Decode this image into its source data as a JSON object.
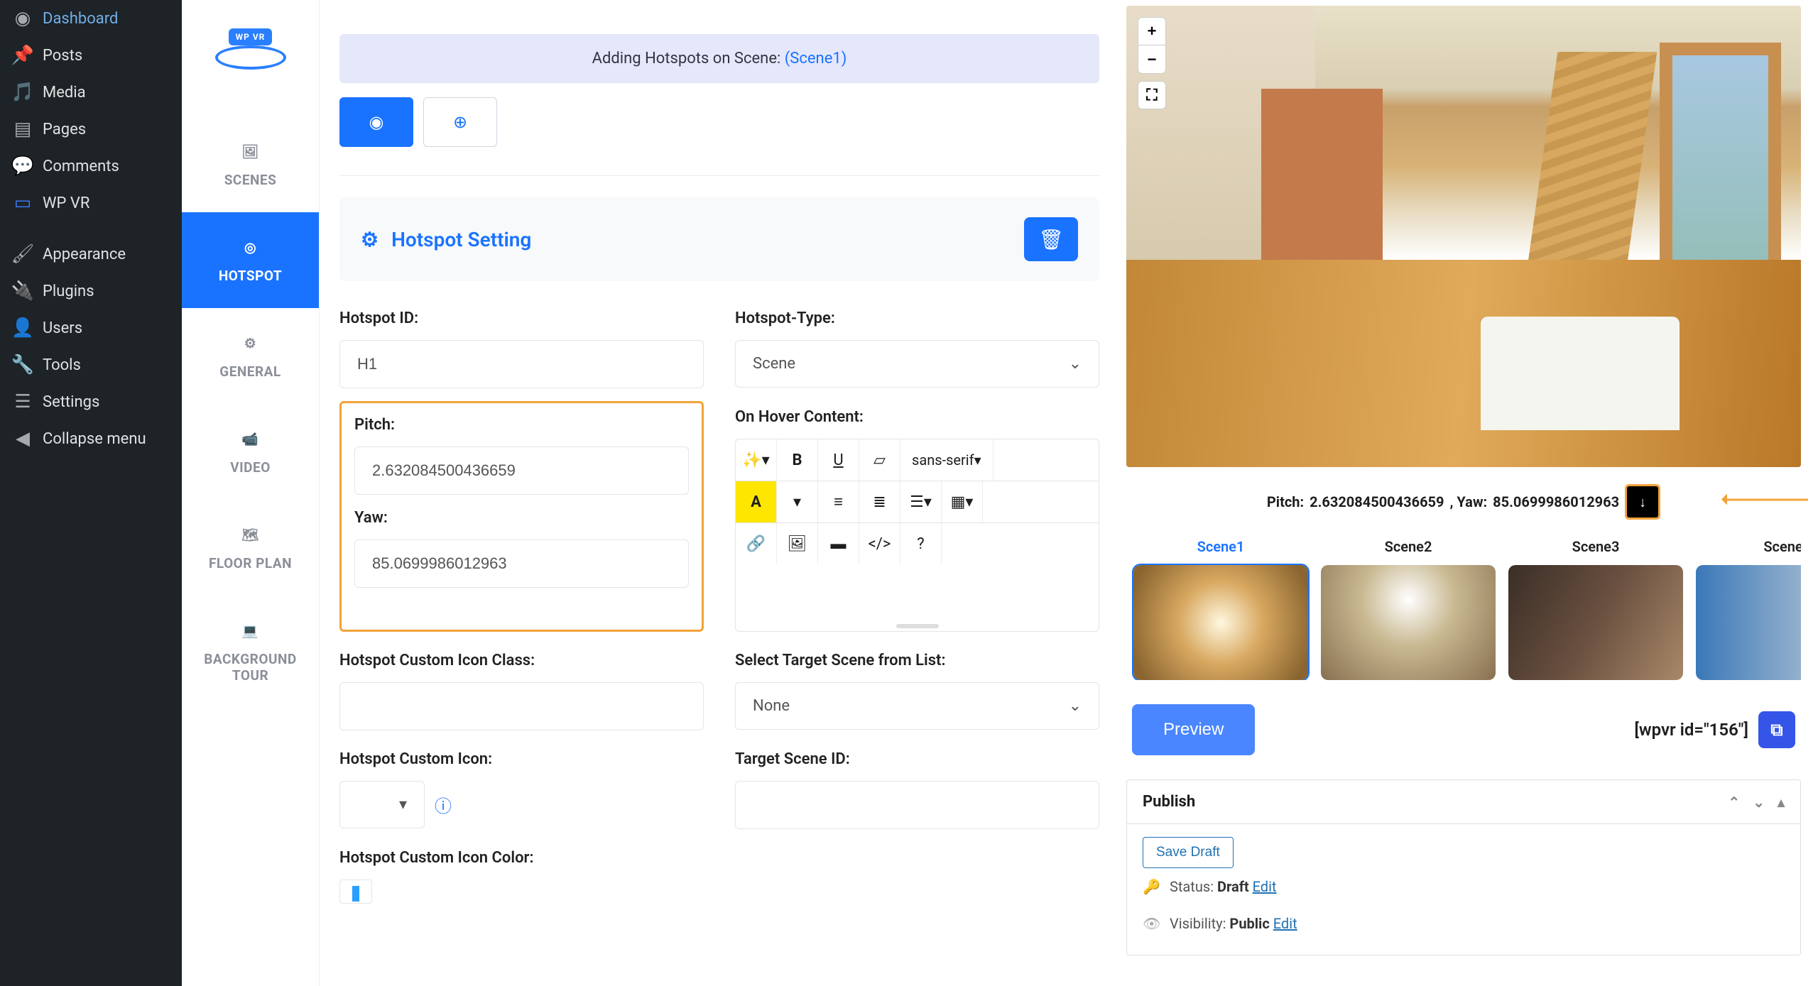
{
  "wp_menu": [
    {
      "label": "Dashboard",
      "icon": "◉"
    },
    {
      "label": "Posts",
      "icon": "✚"
    },
    {
      "label": "Media",
      "icon": "▣"
    },
    {
      "label": "Pages",
      "icon": "▤"
    },
    {
      "label": "Comments",
      "icon": "💬"
    },
    {
      "label": "WP VR",
      "icon": "▭"
    },
    {
      "label": "Appearance",
      "icon": "✎"
    },
    {
      "label": "Plugins",
      "icon": "▦"
    },
    {
      "label": "Users",
      "icon": "👤"
    },
    {
      "label": "Tools",
      "icon": "🔧"
    },
    {
      "label": "Settings",
      "icon": "☰"
    },
    {
      "label": "Collapse menu",
      "icon": "◀"
    }
  ],
  "logo_text": "WP VR",
  "vtabs": [
    {
      "key": "scenes",
      "label": "SCENES"
    },
    {
      "key": "hotspot",
      "label": "HOTSPOT"
    },
    {
      "key": "general",
      "label": "GENERAL"
    },
    {
      "key": "video",
      "label": "VIDEO"
    },
    {
      "key": "floorplan",
      "label": "FLOOR PLAN"
    },
    {
      "key": "bgtour",
      "label": "BACKGROUND TOUR"
    }
  ],
  "banner_prefix": "Adding Hotspots on Scene: ",
  "banner_scene": "(Scene1)",
  "panel_title": "Hotspot Setting",
  "labels": {
    "hotspot_id": "Hotspot ID:",
    "hotspot_type": "Hotspot-Type:",
    "pitch": "Pitch:",
    "yaw": "Yaw:",
    "hover": "On Hover Content:",
    "custom_icon_class": "Hotspot Custom Icon Class:",
    "target_scene_list": "Select Target Scene from List:",
    "custom_icon": "Hotspot Custom Icon:",
    "target_scene_id": "Target Scene ID:",
    "custom_icon_color": "Hotspot Custom Icon Color:"
  },
  "values": {
    "hotspot_id": "H1",
    "hotspot_type": "Scene",
    "pitch": "2.632084500436659",
    "yaw": "85.0699986012963",
    "target_scene": "None",
    "icon_class": "",
    "font": "sans-serif"
  },
  "coords_pitch_label": "Pitch: ",
  "coords_pitch_val": "2.632084500436659",
  "coords_yaw_label": ", Yaw: ",
  "coords_yaw_val": "85.0699986012963",
  "scenes": [
    "Scene1",
    "Scene2",
    "Scene3",
    "Scene"
  ],
  "preview_btn": "Preview",
  "shortcode": "[wpvr id=\"156\"]",
  "publish": {
    "title": "Publish",
    "save_draft": "Save Draft",
    "status_label": "Status: ",
    "status_value": "Draft",
    "visibility_label": "Visibility: ",
    "visibility_value": "Public",
    "edit": "Edit"
  }
}
